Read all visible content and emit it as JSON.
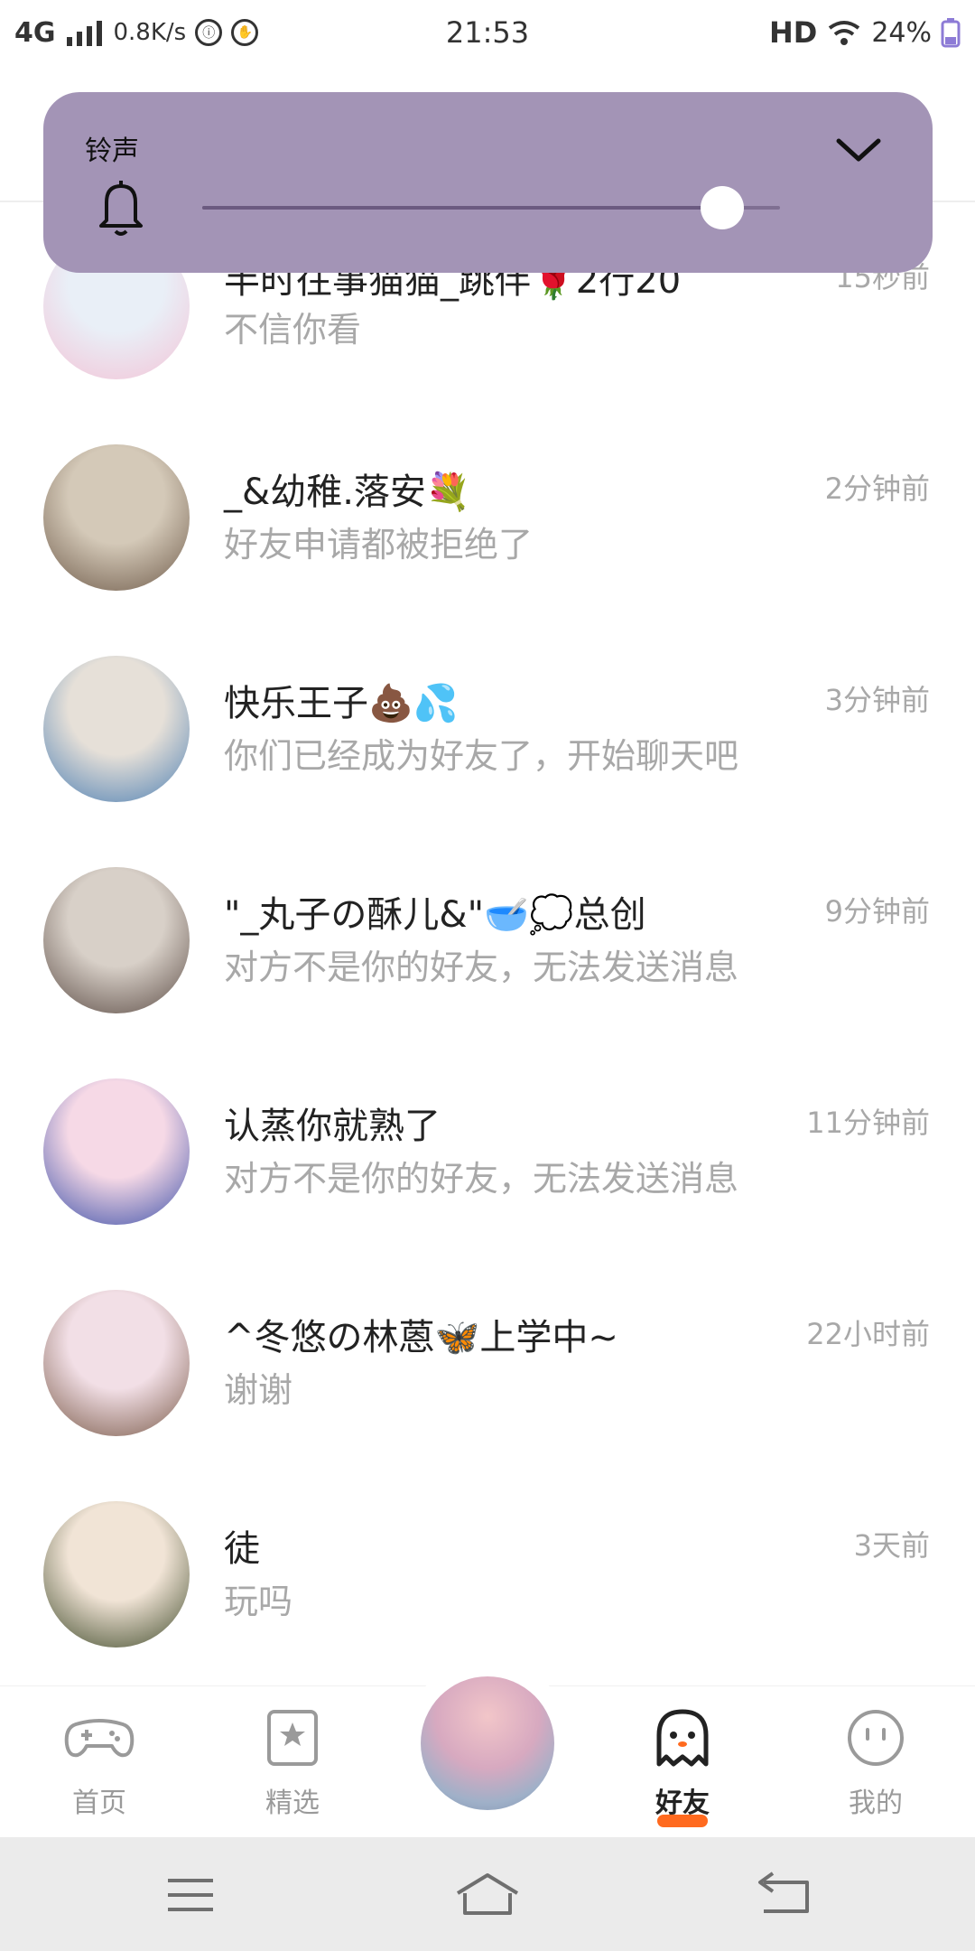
{
  "status_bar": {
    "network": "4G",
    "speed": "0.8K/s",
    "time": "21:53",
    "hd": "HD",
    "battery": "24%"
  },
  "volume_panel": {
    "label": "铃声",
    "level": 0.9,
    "icon": "bell-icon",
    "collapse_icon": "chevron-down-icon"
  },
  "chats": [
    {
      "name": "半时往事猫猫_跳伴🌹2行20",
      "message": "不信你看",
      "time": "15秒前",
      "avatar_colors": [
        "#e9eff7",
        "#f3c3d6"
      ]
    },
    {
      "name": "_&幼稚.落安💐",
      "message": "好友申请都被拒绝了",
      "time": "2分钟前",
      "avatar_colors": [
        "#d4c9b8",
        "#6f5b4a"
      ]
    },
    {
      "name": "快乐王子💩💦",
      "message": "你们已经成为好友了，开始聊天吧",
      "time": "3分钟前",
      "avatar_colors": [
        "#e6e0d8",
        "#4d7fb3"
      ]
    },
    {
      "name": "\"_丸子の酥儿&\"🥣💭总创",
      "message": "对方不是你的好友，无法发送消息",
      "time": "9分钟前",
      "avatar_colors": [
        "#d8d0c8",
        "#5c4c45"
      ]
    },
    {
      "name": "认蒸你就熟了",
      "message": "对方不是你的好友，无法发送消息",
      "time": "11分钟前",
      "avatar_colors": [
        "#f6d9e6",
        "#3b4fa8"
      ]
    },
    {
      "name": "^冬悠の林蒽🦋上学中~",
      "message": "谢谢",
      "time": "22小时前",
      "avatar_colors": [
        "#f2dfe6",
        "#7a5a48"
      ]
    },
    {
      "name": "徒",
      "message": "玩吗",
      "time": "3天前",
      "avatar_colors": [
        "#f1e4d6",
        "#3f4a2a"
      ]
    }
  ],
  "bottom_nav": {
    "items": [
      {
        "label": "首页",
        "icon": "gamepad-icon",
        "active": false
      },
      {
        "label": "精选",
        "icon": "star-badge-icon",
        "active": false
      },
      {
        "label": "好友",
        "icon": "ghost-icon",
        "active": true
      },
      {
        "label": "我的",
        "icon": "smiley-face-icon",
        "active": false
      }
    ],
    "accent_color": "#ff6a1f"
  },
  "system_nav": {
    "icons": [
      "menu-icon",
      "home-icon",
      "back-icon"
    ]
  },
  "colors": {
    "panel": "#a394b6",
    "secondary_text": "#a8a8a8"
  }
}
